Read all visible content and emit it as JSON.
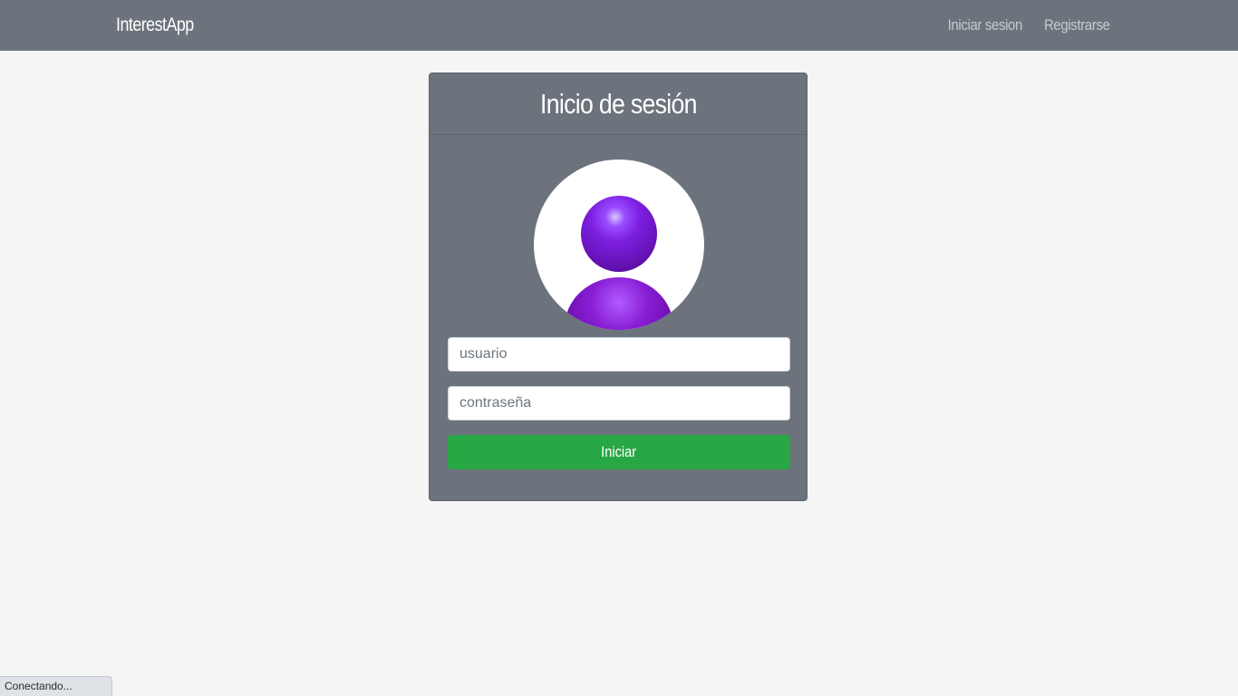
{
  "navbar": {
    "brand": "InterestApp",
    "links": [
      {
        "label": "Iniciar sesion"
      },
      {
        "label": "Registrarse"
      }
    ]
  },
  "login": {
    "title": "Inicio de sesión",
    "avatar_icon": "user-avatar-icon",
    "username": {
      "placeholder": "usuario",
      "value": ""
    },
    "password": {
      "placeholder": "contraseña",
      "value": ""
    },
    "submit_label": "Iniciar"
  },
  "status": {
    "text": "Conectando..."
  },
  "colors": {
    "navbar_bg": "#6c737c",
    "page_bg": "#f4f5f4",
    "card_bg": "#6c737c",
    "submit_button": "#28a745",
    "avatar_accent": "#7c1fe0"
  }
}
